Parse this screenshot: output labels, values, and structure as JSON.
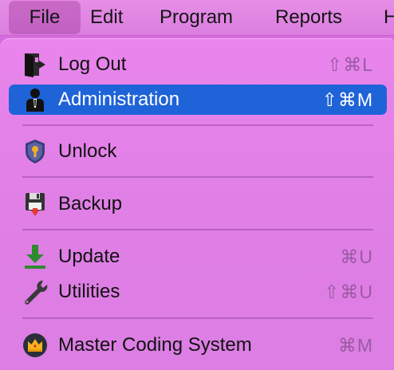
{
  "menubar": {
    "items": [
      {
        "label": "File"
      },
      {
        "label": "Edit"
      },
      {
        "label": "Program"
      },
      {
        "label": "Reports"
      },
      {
        "label": "H"
      }
    ]
  },
  "menu": {
    "items": [
      {
        "label": "Log Out",
        "shortcut": "⇧⌘L",
        "icon": "logout-door-icon"
      },
      {
        "label": "Administration",
        "shortcut": "⇧⌘M",
        "icon": "admin-person-icon",
        "selected": true
      },
      {
        "label": "Unlock",
        "shortcut": "",
        "icon": "shield-lock-icon"
      },
      {
        "label": "Backup",
        "shortcut": "",
        "icon": "floppy-backup-icon"
      },
      {
        "label": "Update",
        "shortcut": "⌘U",
        "icon": "download-arrow-icon"
      },
      {
        "label": "Utilities",
        "shortcut": "⇧⌘U",
        "icon": "wrench-icon"
      },
      {
        "label": "Master Coding System",
        "shortcut": "⌘M",
        "icon": "crown-badge-icon"
      }
    ]
  },
  "colors": {
    "selection": "#1f63d8",
    "menu_background": "#e07fe6",
    "shortcut_text": "#9a5aa2"
  }
}
